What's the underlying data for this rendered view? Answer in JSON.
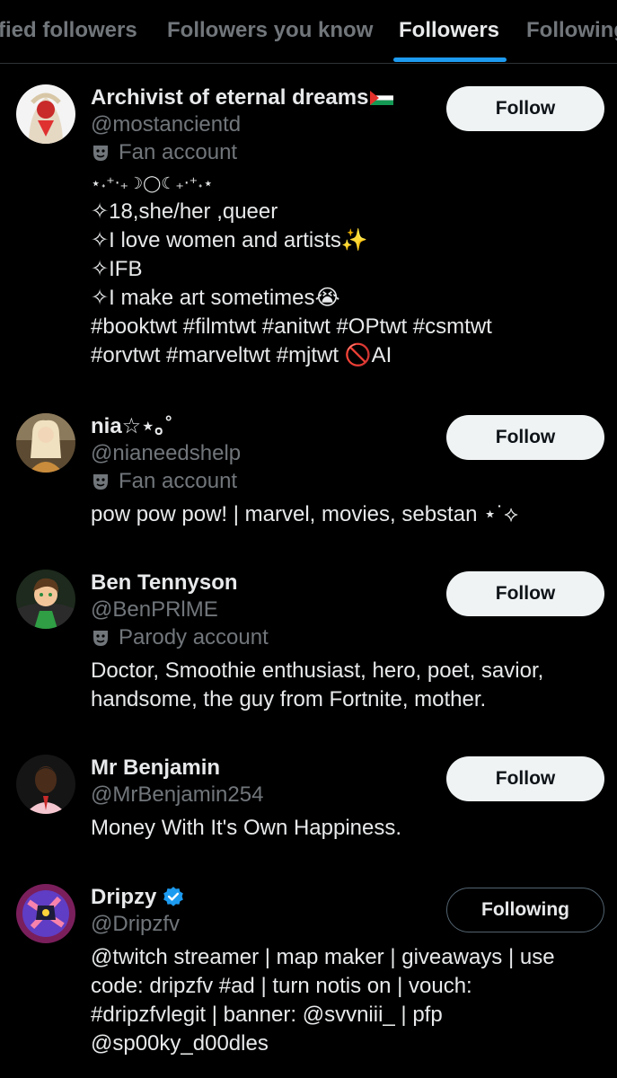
{
  "tabs": [
    {
      "label": "fied followers",
      "active": false
    },
    {
      "label": "Followers you know",
      "active": false
    },
    {
      "label": "Followers",
      "active": true
    },
    {
      "label": "Following",
      "active": false
    }
  ],
  "accent_color": "#1d9bf0",
  "users": [
    {
      "name": "Archivist of eternal dreams",
      "name_badge": "palestine-flag-icon",
      "handle": "@mostancientd",
      "label": "Fan account",
      "bio": [
        "⋆˖⁺‧₊☽◯☾₊‧⁺˖⋆",
        "✧18,she/her ,queer",
        "✧I love women and artists✨",
        "✧IFB",
        "✧I make art sometimes😭",
        "#booktwt #filmtwt #anitwt #OPtwt #csmtwt",
        "#orvtwt #marveltwt #mjtwt 🚫AI"
      ],
      "button": "Follow"
    },
    {
      "name": "nia☆⋆｡˚",
      "handle": "@nianeedshelp",
      "label": "Fan account",
      "bio": [
        "pow pow pow! | marvel, movies, sebstan ⋆˙⟡"
      ],
      "button": "Follow"
    },
    {
      "name": "Ben Tennyson",
      "handle": "@BenPRlME",
      "label": "Parody account",
      "bio": [
        "Doctor, Smoothie enthusiast, hero, poet, savior,",
        "handsome, the guy from Fortnite, mother."
      ],
      "button": "Follow"
    },
    {
      "name": "Mr Benjamin",
      "handle": "@MrBenjamin254",
      "bio": [
        "Money With It's Own Happiness."
      ],
      "button": "Follow"
    },
    {
      "name": "Dripzy",
      "verified": true,
      "handle": "@Dripzfv",
      "bio": [
        "@twitch streamer | map maker | giveaways | use",
        "code: dripzfv #ad | turn notis on | vouch:",
        "#dripzfvlegit | banner: @svvniii_ | pfp",
        "@sp00ky_d00dles"
      ],
      "button": "Following"
    }
  ]
}
